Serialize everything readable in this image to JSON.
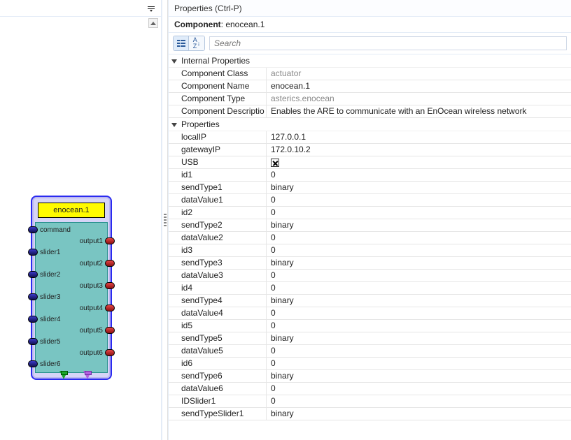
{
  "canvas": {
    "component_label": "enocean.1",
    "left_ports": [
      "command",
      "slider1",
      "slider2",
      "slider3",
      "slider4",
      "slider5",
      "slider6"
    ],
    "right_ports": [
      "output1",
      "output2",
      "output3",
      "output4",
      "output5",
      "output6"
    ]
  },
  "props": {
    "titlebar": "Properties (Ctrl-P)",
    "header_label": "Component",
    "header_value": "enocean.1",
    "search_placeholder": "Search",
    "groups": [
      {
        "name": "Internal Properties",
        "rows": [
          {
            "key": "Component Class",
            "value": "actuator",
            "dim": true
          },
          {
            "key": "Component Name",
            "value": "enocean.1"
          },
          {
            "key": "Component Type",
            "value": "asterics.enocean",
            "dim": true
          },
          {
            "key": "Component Descriptio",
            "value": "Enables the ARE to communicate with an EnOcean wireless network"
          }
        ]
      },
      {
        "name": "Properties",
        "rows": [
          {
            "key": "localIP",
            "value": "127.0.0.1"
          },
          {
            "key": "gatewayIP",
            "value": "172.0.10.2"
          },
          {
            "key": "USB",
            "value": "[x]"
          },
          {
            "key": "id1",
            "value": "0"
          },
          {
            "key": "sendType1",
            "value": "binary"
          },
          {
            "key": "dataValue1",
            "value": "0"
          },
          {
            "key": "id2",
            "value": "0"
          },
          {
            "key": "sendType2",
            "value": "binary"
          },
          {
            "key": "dataValue2",
            "value": "0"
          },
          {
            "key": "id3",
            "value": "0"
          },
          {
            "key": "sendType3",
            "value": "binary"
          },
          {
            "key": "dataValue3",
            "value": "0"
          },
          {
            "key": "id4",
            "value": "0"
          },
          {
            "key": "sendType4",
            "value": "binary"
          },
          {
            "key": "dataValue4",
            "value": "0"
          },
          {
            "key": "id5",
            "value": "0"
          },
          {
            "key": "sendType5",
            "value": "binary"
          },
          {
            "key": "dataValue5",
            "value": "0"
          },
          {
            "key": "id6",
            "value": "0"
          },
          {
            "key": "sendType6",
            "value": "binary"
          },
          {
            "key": "dataValue6",
            "value": "0"
          },
          {
            "key": "IDSlider1",
            "value": "0"
          },
          {
            "key": "sendTypeSlider1",
            "value": "binary"
          }
        ]
      }
    ]
  }
}
